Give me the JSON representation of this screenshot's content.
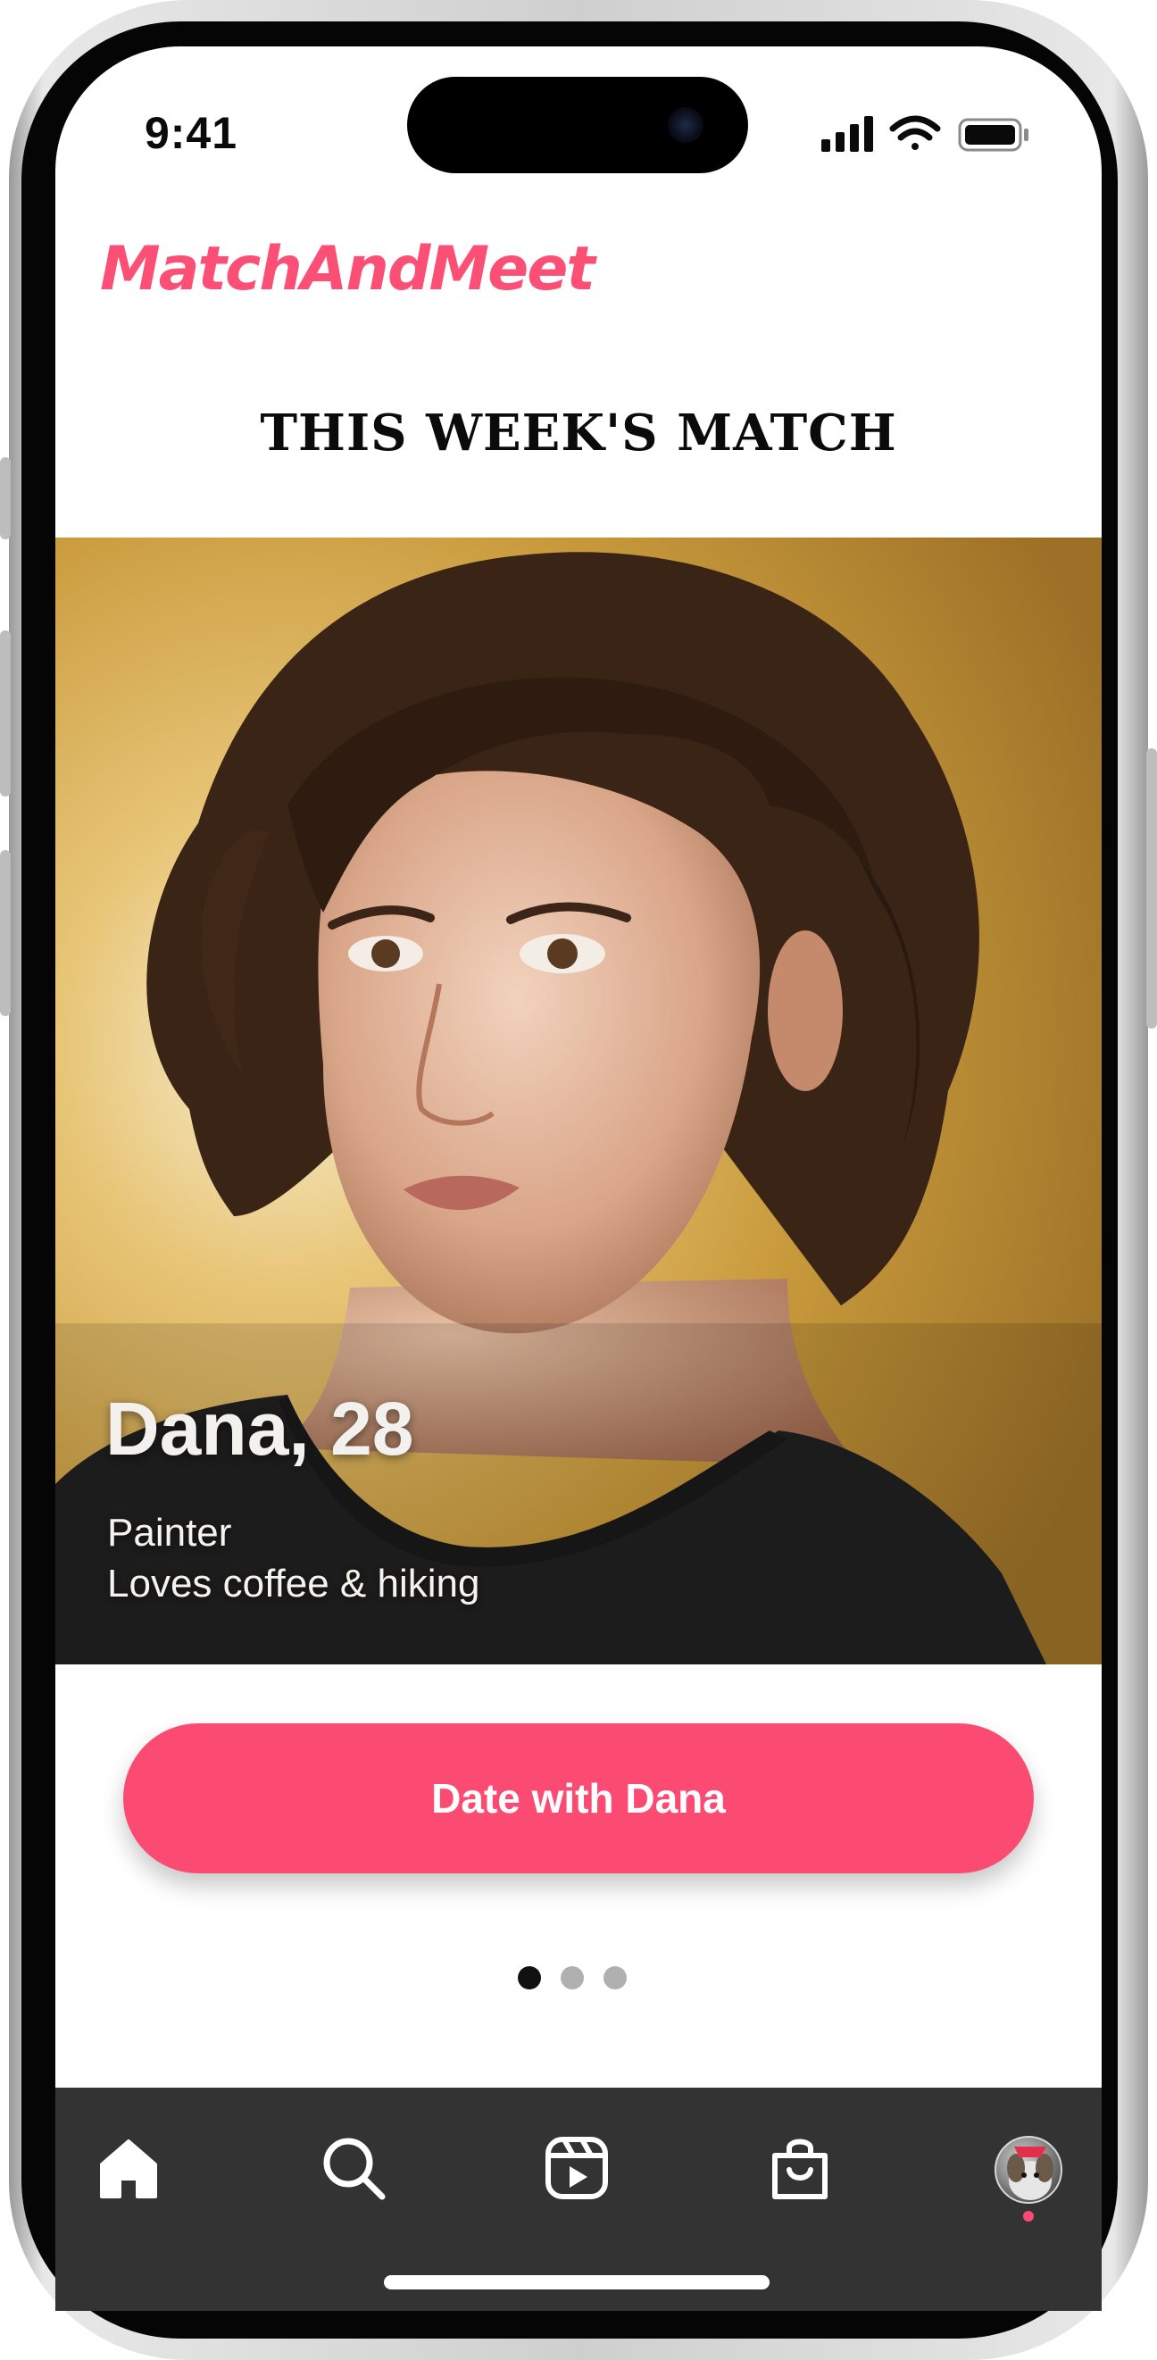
{
  "status_bar": {
    "time": "9:41"
  },
  "app": {
    "name": "MatchAndMeet",
    "brand_color": "#fc4b73"
  },
  "main": {
    "section_title": "THIS WEEK'S MATCH",
    "profile": {
      "name_age": "Dana, 28",
      "occupation": "Painter",
      "bio": "Loves coffee & hiking"
    },
    "cta_label": "Date with Dana",
    "pagination": {
      "total": 3,
      "active": 1
    }
  },
  "tab_bar": {
    "items": [
      {
        "icon": "home-icon",
        "selected": true
      },
      {
        "icon": "search-icon"
      },
      {
        "icon": "reels-icon"
      },
      {
        "icon": "shop-bag-icon"
      },
      {
        "icon": "profile-avatar",
        "has_notification": true
      }
    ]
  }
}
